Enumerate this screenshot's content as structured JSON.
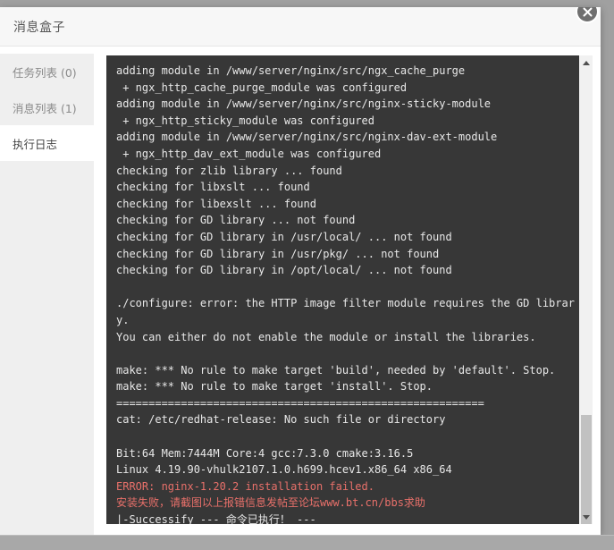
{
  "dialog": {
    "title": "消息盒子",
    "close_label": "×"
  },
  "sidebar": {
    "items": [
      {
        "label": "任务列表 (0)",
        "name": "task-list",
        "active": false
      },
      {
        "label": "消息列表 (1)",
        "name": "message-list",
        "active": false
      },
      {
        "label": "执行日志",
        "name": "execution-log",
        "active": true
      }
    ]
  },
  "log": {
    "lines": [
      {
        "text": "adding module in /www/server/nginx/src/ngx_cache_purge",
        "error": false
      },
      {
        "text": " + ngx_http_cache_purge_module was configured",
        "error": false
      },
      {
        "text": "adding module in /www/server/nginx/src/nginx-sticky-module",
        "error": false
      },
      {
        "text": " + ngx_http_sticky_module was configured",
        "error": false
      },
      {
        "text": "adding module in /www/server/nginx/src/nginx-dav-ext-module",
        "error": false
      },
      {
        "text": " + ngx_http_dav_ext_module was configured",
        "error": false
      },
      {
        "text": "checking for zlib library ... found",
        "error": false
      },
      {
        "text": "checking for libxslt ... found",
        "error": false
      },
      {
        "text": "checking for libexslt ... found",
        "error": false
      },
      {
        "text": "checking for GD library ... not found",
        "error": false
      },
      {
        "text": "checking for GD library in /usr/local/ ... not found",
        "error": false
      },
      {
        "text": "checking for GD library in /usr/pkg/ ... not found",
        "error": false
      },
      {
        "text": "checking for GD library in /opt/local/ ... not found",
        "error": false
      },
      {
        "text": "",
        "error": false
      },
      {
        "text": "./configure: error: the HTTP image filter module requires the GD library.",
        "error": false
      },
      {
        "text": "You can either do not enable the module or install the libraries.",
        "error": false
      },
      {
        "text": "",
        "error": false
      },
      {
        "text": "make: *** No rule to make target 'build', needed by 'default'. Stop.",
        "error": false
      },
      {
        "text": "make: *** No rule to make target 'install'. Stop.",
        "error": false
      },
      {
        "text": "=========================================================",
        "error": false
      },
      {
        "text": "cat: /etc/redhat-release: No such file or directory",
        "error": false
      },
      {
        "text": "",
        "error": false
      },
      {
        "text": "Bit:64 Mem:7444M Core:4 gcc:7.3.0 cmake:3.16.5",
        "error": false
      },
      {
        "text": "Linux 4.19.90-vhulk2107.1.0.h699.hcev1.x86_64 x86_64",
        "error": false
      },
      {
        "text": "ERROR: nginx-1.20.2 installation failed.",
        "error": true
      },
      {
        "text": "安装失败，请截图以上报错信息发帖至论坛www.bt.cn/bbs求助",
        "error": true
      },
      {
        "text": "|-Successify --- 命令已执行！ ---",
        "error": false
      }
    ]
  },
  "scrollbar": {
    "up_arrow": "scroll-up",
    "down_arrow": "scroll-down",
    "thumb": "scroll-thumb"
  }
}
